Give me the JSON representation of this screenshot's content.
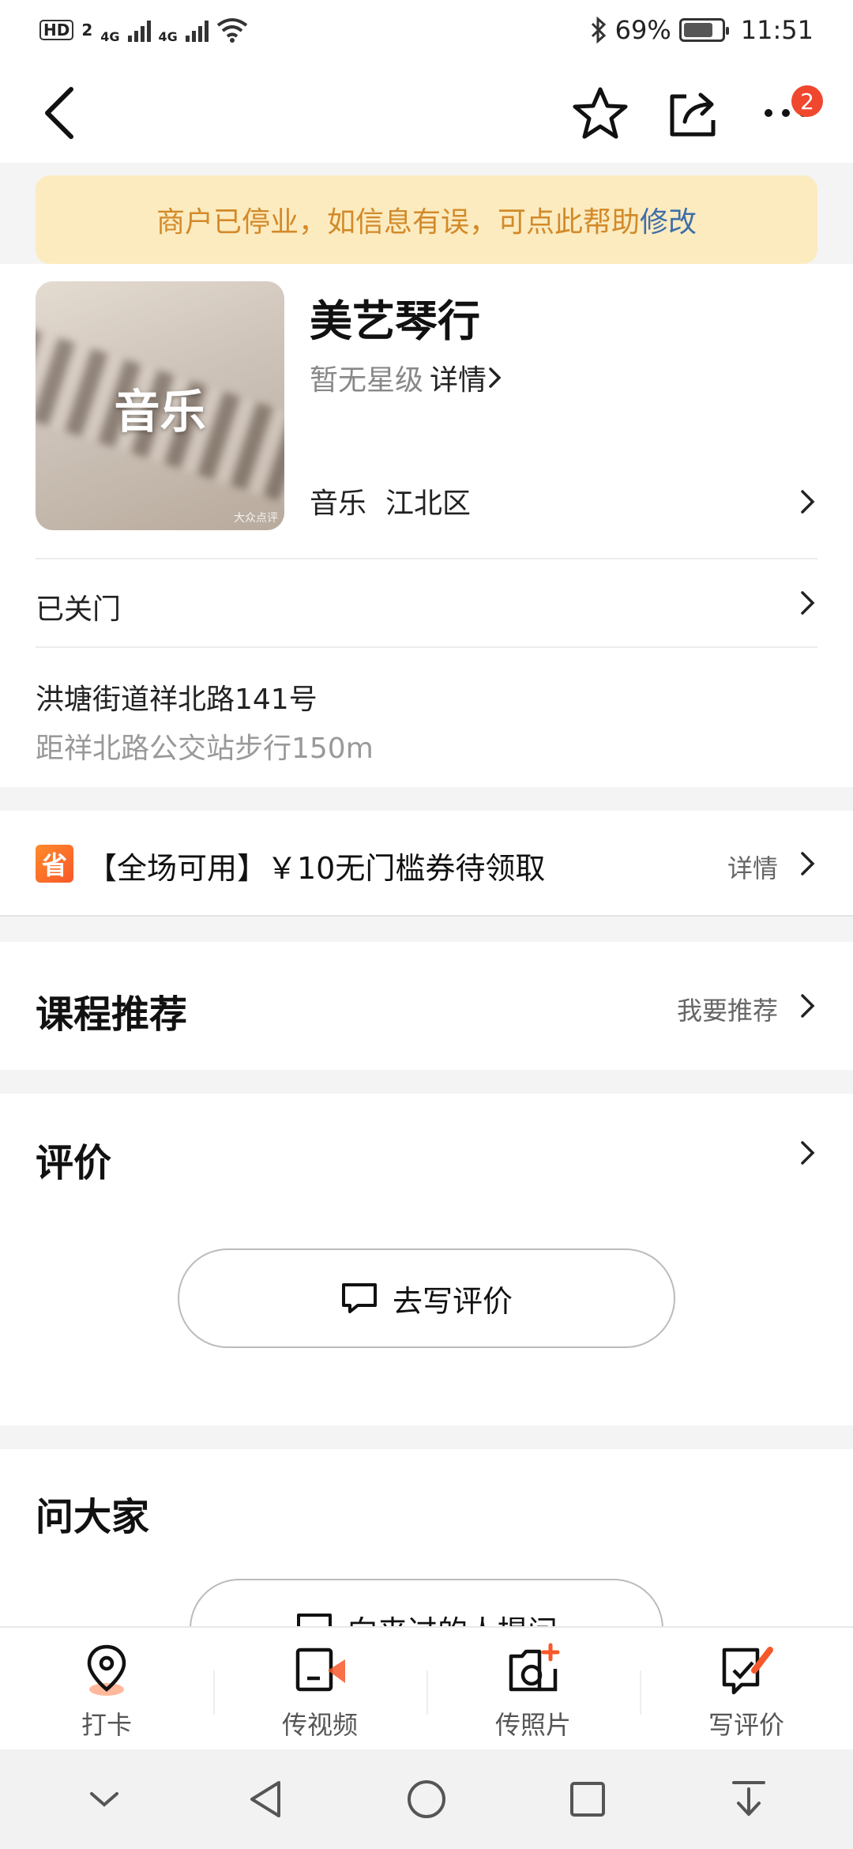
{
  "status_bar": {
    "left_hd": "HD",
    "left_sim": "2",
    "network_1": "4G",
    "network_2": "4G",
    "battery_pct": "69%",
    "time": "11:51"
  },
  "nav": {
    "more_badge": "2"
  },
  "notice": {
    "text": "商户已停业，如信息有误，可点此帮助",
    "action": "修改"
  },
  "shop": {
    "thumbnail_label": "音乐",
    "thumbnail_watermark": "大众点评",
    "name": "美艺琴行",
    "rating_text": "暂无星级",
    "rating_detail": "详情",
    "category": "音乐",
    "district": "江北区",
    "status": "已关门",
    "address": "洪塘街道祥北路141号",
    "distance": "距祥北路公交站步行150m"
  },
  "coupon": {
    "tag": "省",
    "text": "【全场可用】￥10无门槛券待领取",
    "detail": "详情"
  },
  "courses": {
    "title": "课程推荐",
    "link": "我要推荐"
  },
  "reviews": {
    "title": "评价",
    "button": "去写评价"
  },
  "ask": {
    "title": "问大家",
    "button": "向来过的人提问"
  },
  "bottom_tabs": [
    {
      "label": "打卡",
      "icon": "location-pin-icon"
    },
    {
      "label": "传视频",
      "icon": "upload-video-icon"
    },
    {
      "label": "传照片",
      "icon": "upload-photo-icon"
    },
    {
      "label": "写评价",
      "icon": "write-review-icon"
    }
  ],
  "colors": {
    "accent_orange": "#f7582a",
    "notice_bg": "#fcebbf",
    "notice_text": "#d28a2a",
    "notice_link": "#3f6ea8",
    "badge_red": "#f0472f"
  }
}
